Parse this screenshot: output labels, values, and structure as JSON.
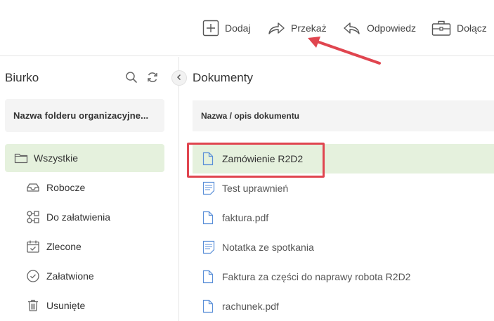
{
  "toolbar": {
    "add_label": "Dodaj",
    "forward_label": "Przekaż",
    "reply_label": "Odpowiedz",
    "attach_label": "Dołącz"
  },
  "left_panel": {
    "title": "Biurko",
    "folder_name": "Nazwa folderu organizacyjne...",
    "items": [
      {
        "label": "Wszystkie",
        "icon": "folder-icon",
        "active": true
      },
      {
        "label": "Robocze",
        "icon": "inbox-tray-icon"
      },
      {
        "label": "Do załatwienia",
        "icon": "workflow-icon"
      },
      {
        "label": "Zlecone",
        "icon": "calendar-check-icon"
      },
      {
        "label": "Załatwione",
        "icon": "check-circle-icon"
      },
      {
        "label": "Usunięte",
        "icon": "trash-icon"
      }
    ]
  },
  "right_panel": {
    "title": "Dokumenty",
    "column_header": "Nazwa / opis dokumentu",
    "documents": [
      {
        "name": "Zamówienie R2D2",
        "icon": "file-icon",
        "selected": true
      },
      {
        "name": "Test uprawnień",
        "icon": "note-icon"
      },
      {
        "name": "faktura.pdf",
        "icon": "file-icon"
      },
      {
        "name": "Notatka ze spotkania",
        "icon": "note-icon"
      },
      {
        "name": "Faktura za części do naprawy robota R2D2",
        "icon": "file-icon"
      },
      {
        "name": "rachunek.pdf",
        "icon": "file-icon"
      }
    ]
  },
  "colors": {
    "selected_bg": "#e5f1dd",
    "annotation": "#e0454f",
    "icon_blue": "#5a8fd8"
  }
}
